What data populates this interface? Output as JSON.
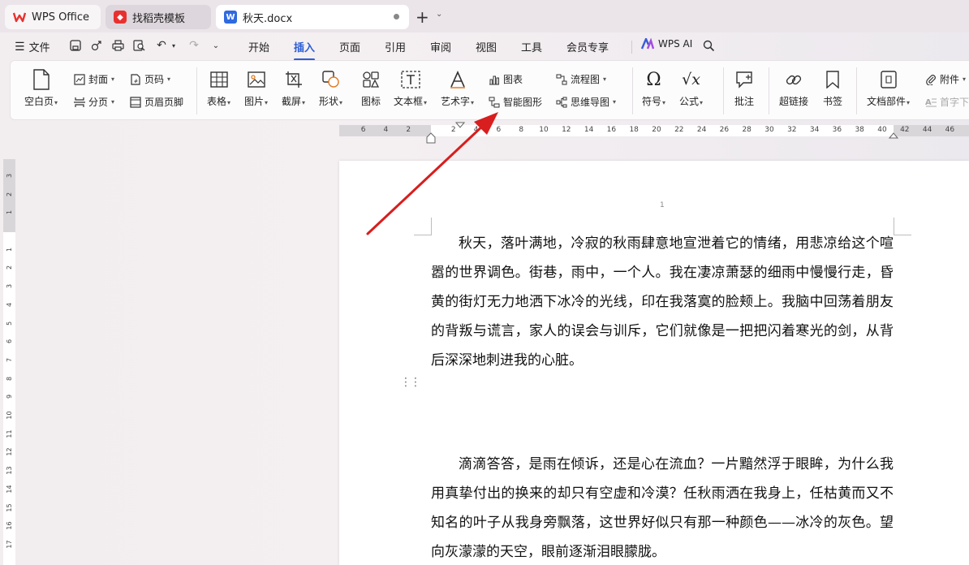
{
  "tabs": {
    "wps": "WPS Office",
    "template": "找稻壳模板",
    "doc": "秋天.docx"
  },
  "menu": {
    "file": "文件",
    "tabs": [
      "开始",
      "插入",
      "页面",
      "引用",
      "审阅",
      "视图",
      "工具",
      "会员专享"
    ],
    "active": "插入",
    "ai": "WPS AI"
  },
  "ribbon": {
    "blank_page": "空白页",
    "cover": "封面",
    "page_num": "页码",
    "page_break": "分页",
    "header_footer": "页眉页脚",
    "table": "表格",
    "picture": "图片",
    "screenshot": "截屏",
    "shape": "形状",
    "icon": "图标",
    "textbox": "文本框",
    "wordart": "艺术字",
    "chart": "图表",
    "smart_graphic": "智能图形",
    "flowchart": "流程图",
    "mindmap": "思维导图",
    "symbol": "符号",
    "formula": "公式",
    "comment": "批注",
    "hyperlink": "超链接",
    "bookmark": "书签",
    "doc_parts": "文档部件",
    "attachment": "附件",
    "dropcap": "首字下"
  },
  "ruler_h": [
    "6",
    "4",
    "2",
    "2",
    "4",
    "6",
    "8",
    "10",
    "12",
    "14",
    "16",
    "18",
    "20",
    "22",
    "24",
    "26",
    "28",
    "30",
    "32",
    "34",
    "36",
    "38",
    "40",
    "42",
    "44",
    "46"
  ],
  "ruler_v": [
    "3",
    "2",
    "1",
    "1",
    "2",
    "3",
    "4",
    "5",
    "6",
    "7",
    "8",
    "9",
    "10",
    "11",
    "12",
    "13",
    "14",
    "15",
    "16",
    "17"
  ],
  "document": {
    "page_number": "1",
    "para1": "秋天，落叶满地，冷寂的秋雨肆意地宣泄着它的情绪，用悲凉给这个喧嚣的世界调色。街巷，雨中，一个人。我在凄凉萧瑟的细雨中慢慢行走，昏黄的街灯无力地洒下冰冷的光线，印在我落寞的脸颊上。我脑中回荡着朋友的背叛与谎言，家人的误会与训斥，它们就像是一把把闪着寒光的剑，从背后深深地刺进我的心脏。",
    "para2": "滴滴答答，是雨在倾诉，还是心在流血？一片黯然浮于眼眸，为什么我用真挚付出的换来的却只有空虚和冷漠？任秋雨洒在我身上，任枯黄而又不知名的叶子从我身旁飘落，这世界好似只有那一种颜色——冰冷的灰色。望向灰濛濛的天空，眼前逐渐泪眼朦胧。"
  },
  "colors": {
    "accent": "#2c5fd6",
    "wps_red": "#e8312f",
    "doc_blue": "#2f6ae0",
    "arrow_red": "#d81e1e"
  }
}
